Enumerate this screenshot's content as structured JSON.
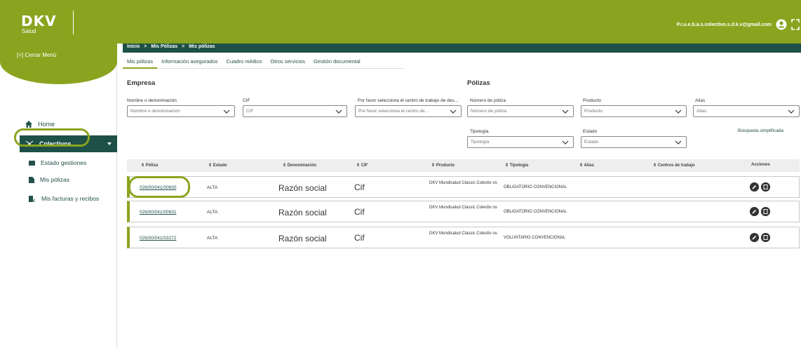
{
  "header": {
    "logo": "DKV",
    "logo_sub": "Salud",
    "user_email": "P.r.u.e.b.a.s.colectivo.s.d.k.v@gmail.com",
    "user_icon": "user-icon",
    "expand_icon": "expand-icon"
  },
  "sidebar": {
    "close_menu": "[<] Cerrar Menú",
    "home": "Home",
    "colectivos": "Colectivos",
    "sub_items": [
      "Estado gestiones",
      "Mis pólizas",
      "Mis facturas y recibos"
    ]
  },
  "breadcrumb": [
    "Inicio",
    ">",
    "Mis Pólizas",
    ">",
    "Mis pólizas"
  ],
  "tabs": [
    "Mis pólizas",
    "Información asegurados",
    "Cuadro médico",
    "Otros servicios",
    "Gestión documental"
  ],
  "filters": {
    "empresa_title": "Empresa",
    "polizas_title": "Pólizas",
    "nombre_label": "Nombre o denominación",
    "nombre_placeholder": "Nombre o denominación",
    "cif_label": "CIF",
    "cif_placeholder": "CIF",
    "centro_label": "Por favor selecciona el centro de trabajo de des...",
    "centro_placeholder": "Por favor selecciona el centro de...",
    "numero_label": "Número de póliza",
    "numero_placeholder": "Número de póliza",
    "producto_label": "Producto",
    "producto_placeholder": "Producto",
    "alias_label": "Alias",
    "alias_placeholder": "Alias",
    "tipologia_label": "Tipología",
    "tipologia_placeholder": "Tipología",
    "estado_label": "Estado",
    "estado_placeholder": "Estado",
    "simple_search": "Búsqueda simplificada"
  },
  "table": {
    "headers": [
      "⇕ Póliza",
      "⇕ Estado",
      "⇕ Denominación",
      "⇕ CIF",
      "⇕ Producto",
      "⇕ Tipología",
      "⇕ Alias",
      "⇕ Centros de trabajo",
      "Acciones"
    ],
    "rows": [
      {
        "poliza": "026/00/041/00630",
        "estado": "ALTA",
        "denominacion": "Razón social",
        "cif": "Cif",
        "producto": "DKV Mundisalud Classic Colectiv os",
        "tipologia": "OBLIGATORIO CONVENCIONAL"
      },
      {
        "poliza": "026/00/041/00631",
        "estado": "ALTA",
        "denominacion": "Razón social",
        "cif": "Cif",
        "producto": "DKV Mundisalud Classic Colectiv os",
        "tipologia": "OBLIGATORIO CONVENCIONAL"
      },
      {
        "poliza": "026/00/041/03272",
        "estado": "ALTA",
        "denominacion": "Razón social",
        "cif": "Cif",
        "producto": "DKV Mundisalud Classic Colectiv os",
        "tipologia": "VOLUNTARIO CONVENCIONAL"
      }
    ]
  }
}
